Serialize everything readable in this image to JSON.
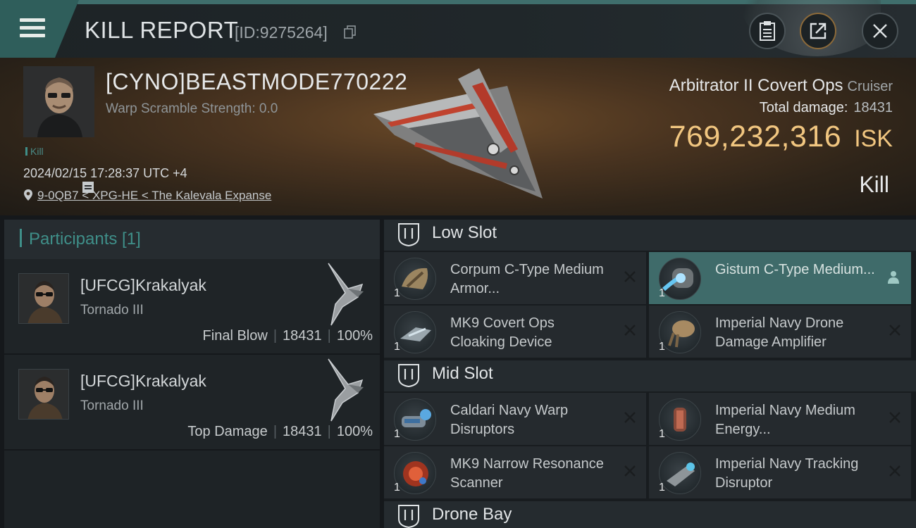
{
  "header": {
    "title": "KILL REPORT",
    "id_text": "[ID:9275264]",
    "menu_icon": "hamburger-menu-icon",
    "buttons": [
      "clipboard-icon",
      "share-icon",
      "close-icon"
    ]
  },
  "victim": {
    "name": "[CYNO]BEASTMODE770222",
    "warp_scramble": "Warp Scramble Strength: 0.0",
    "kill_tag": "Kill",
    "datetime": "2024/02/15 17:28:37 UTC +4",
    "location": "9-0QB7 < XPG-HE < The Kalevala Expanse"
  },
  "ship": {
    "name": "Arbitrator II Covert Ops",
    "class": "Cruiser",
    "total_damage_label": "Total damage:",
    "total_damage": "18431",
    "isk_value": "769,232,316",
    "isk_unit": "ISK",
    "result": "Kill"
  },
  "participants": {
    "title": "Participants [1]",
    "rows": [
      {
        "name": "[UFCG]Krakalyak",
        "ship": "Tornado III",
        "role": "Final Blow",
        "damage": "18431",
        "percent": "100%"
      },
      {
        "name": "[UFCG]Krakalyak",
        "ship": "Tornado III",
        "role": "Top Damage",
        "damage": "18431",
        "percent": "100%"
      }
    ]
  },
  "slots": {
    "low": {
      "title": "Low Slot",
      "modules": [
        {
          "name": "Corpum C-Type Medium Armor...",
          "qty": "1",
          "status": "destroyed"
        },
        {
          "name": "Gistum C-Type Medium...",
          "qty": "1",
          "status": "dropped"
        },
        {
          "name": "MK9 Covert Ops Cloaking Device",
          "qty": "1",
          "status": "destroyed"
        },
        {
          "name": "Imperial Navy Drone Damage Amplifier",
          "qty": "1",
          "status": "destroyed"
        }
      ]
    },
    "mid": {
      "title": "Mid Slot",
      "modules": [
        {
          "name": "Caldari Navy Warp Disruptors",
          "qty": "1",
          "status": "destroyed"
        },
        {
          "name": "Imperial Navy Medium Energy...",
          "qty": "1",
          "status": "destroyed"
        },
        {
          "name": "MK9 Narrow Resonance Scanner",
          "qty": "1",
          "status": "destroyed"
        },
        {
          "name": "Imperial Navy Tracking Disruptor",
          "qty": "1",
          "status": "destroyed"
        }
      ]
    },
    "drone": {
      "title": "Drone Bay"
    }
  },
  "colors": {
    "accent_teal": "#3f8f89",
    "isk_gold": "#f1c680",
    "fitted_highlight": "#3f6b6a"
  }
}
